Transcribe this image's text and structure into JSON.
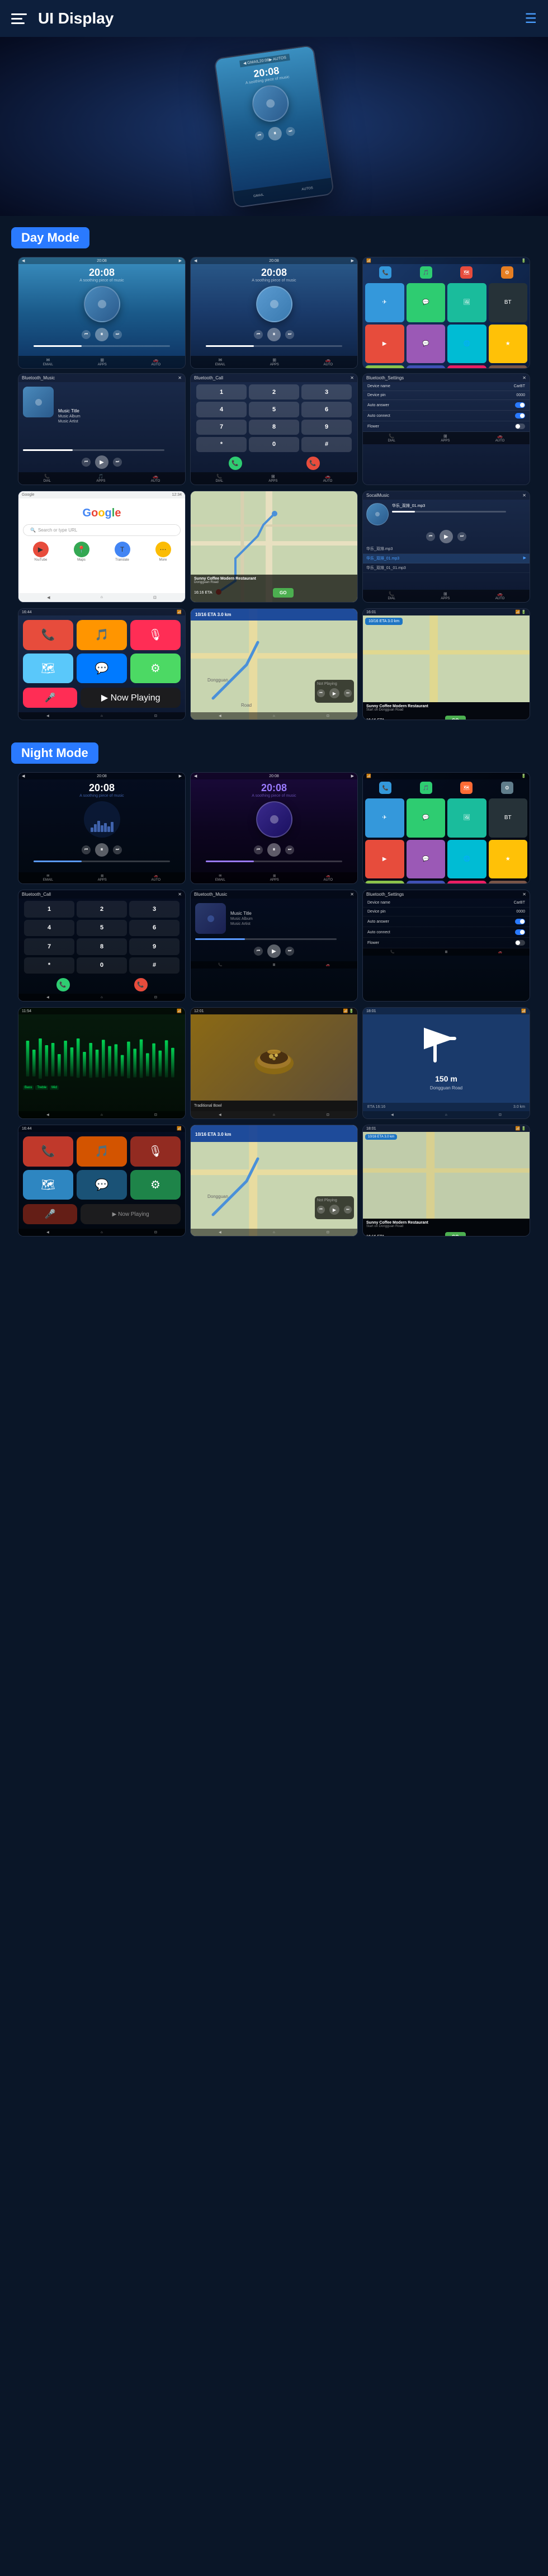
{
  "header": {
    "title": "UI Display",
    "menu_icon": "≡",
    "nav_icon": "☰"
  },
  "sections": {
    "day_mode": {
      "label": "Day Mode",
      "screens": [
        {
          "type": "music_player_day_1",
          "time": "20:08",
          "subtitle": "A soothing piece of music"
        },
        {
          "type": "music_player_day_2",
          "time": "20:08",
          "subtitle": "A soothing piece of music"
        },
        {
          "type": "app_grid_day"
        }
      ]
    },
    "night_mode": {
      "label": "Night Mode",
      "screens": []
    }
  },
  "device": {
    "time": "20:08",
    "date": "A soothing piece of music"
  },
  "music": {
    "title": "Music Title",
    "album": "Music Album",
    "artist": "Music Artist"
  },
  "settings": {
    "device_name_label": "Device name",
    "device_name_value": "CarBT",
    "device_pin_label": "Device pin",
    "device_pin_value": "0000",
    "auto_answer_label": "Auto answer",
    "auto_connect_label": "Auto connect",
    "flower_label": "Flower"
  },
  "restaurant": {
    "name": "Sunny Coffee Modern Restaurant",
    "address": "Dongguan Road",
    "eta_label": "ETA",
    "eta_value": "16:16",
    "distance_value": "3.0 km",
    "go_label": "GO",
    "nav_label": "Start on Dongguan Road"
  },
  "navigation": {
    "distance": "10/16 ETA  3.0 km",
    "start_label": "Start on Dongguan Road",
    "not_playing": "Not Playing"
  },
  "local_music": {
    "files": [
      "华乐_双排.mp3",
      "华乐_01_01_01.mp3",
      "华乐_双排_01.mp3"
    ]
  }
}
